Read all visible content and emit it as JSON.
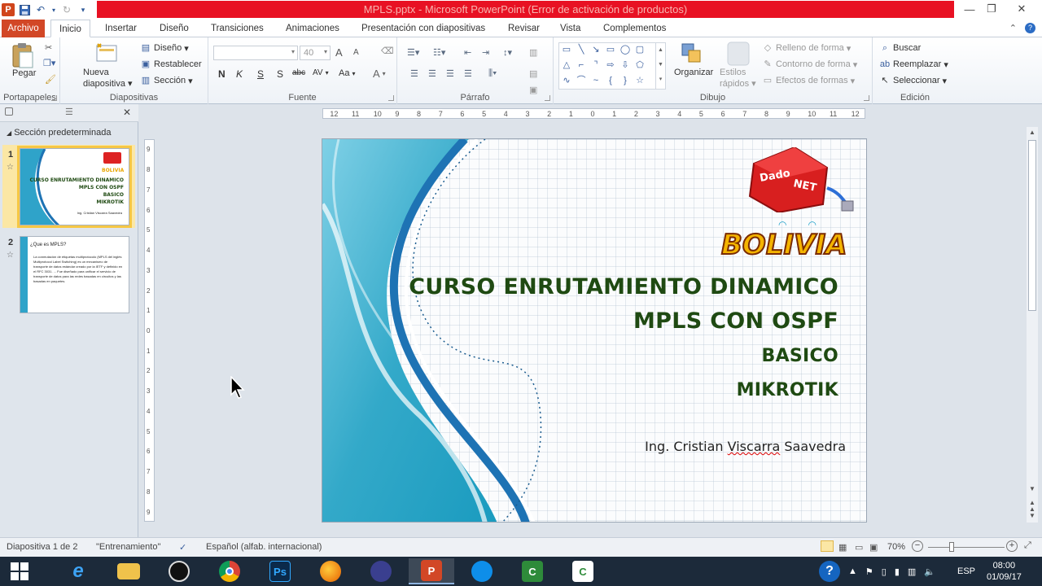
{
  "window": {
    "title": "MPLS.pptx  -  Microsoft PowerPoint (Error de activación de productos)",
    "controls": {
      "minimize": "—",
      "restore": "❐",
      "close": "✕"
    }
  },
  "qat": {
    "logo": "P"
  },
  "tabs": {
    "file": "Archivo",
    "items": [
      "Inicio",
      "Insertar",
      "Diseño",
      "Transiciones",
      "Animaciones",
      "Presentación con diapositivas",
      "Revisar",
      "Vista",
      "Complementos"
    ],
    "active": "Inicio"
  },
  "ribbon": {
    "portapapeles": {
      "label": "Portapapeles",
      "paste": "Pegar"
    },
    "diapositivas": {
      "label": "Diapositivas",
      "new_slide_1": "Nueva",
      "new_slide_2": "diapositiva",
      "layout": "Diseño",
      "reset": "Restablecer",
      "section": "Sección"
    },
    "fuente": {
      "label": "Fuente",
      "font_name": "",
      "font_size": "40",
      "bold": "N",
      "italic": "K",
      "underline": "S",
      "shadow": "S",
      "strike": "abc",
      "spacing": "AV",
      "case": "Aa",
      "color": "A",
      "grow": "A",
      "shrink": "A"
    },
    "parrafo": {
      "label": "Párrafo"
    },
    "dibujo": {
      "label": "Dibujo",
      "arrange": "Organizar",
      "quick_styles_1": "Estilos",
      "quick_styles_2": "rápidos",
      "fill": "Relleno de forma",
      "outline": "Contorno de forma",
      "effects": "Efectos de formas"
    },
    "edicion": {
      "label": "Edición",
      "find": "Buscar",
      "replace": "Reemplazar",
      "select": "Seleccionar"
    }
  },
  "left_panel": {
    "section": "Sección predeterminada",
    "slides": [
      {
        "number": "1",
        "title_line1": "CURSO ENRUTAMIENTO DINAMICO",
        "title_line2": "MPLS CON OSPF",
        "line3": "BASICO",
        "line4": "MIKROTIK",
        "author": "Ing. Cristian Viscarra Saavedra"
      },
      {
        "number": "2",
        "title": "¿Que es MPLS?",
        "body": "La conmutación de etiquetas multiprotocolo (MPLS del inglés Multiprotocol Label Switching) es un mecanismo de transporte de datos estándar creado por la IETF y definido en el RFC 3031. ... Fue diseñado para unificar el servicio de transporte de datos para las redes basadas en circuitos y las basadas en paquetes."
      }
    ]
  },
  "slide": {
    "logo_text": "Dado NET",
    "brand": "BOLIVIA",
    "title_line1": "CURSO ENRUTAMIENTO DINAMICO",
    "title_line2": "MPLS CON OSPF",
    "line3": "BASICO",
    "line4": "MIKROTIK",
    "author_prefix": "Ing. Cristian ",
    "author_squiggle": "Viscarra",
    "author_suffix": " Saavedra"
  },
  "ruler": {
    "h_ticks": [
      "12",
      "11",
      "10",
      "9",
      "8",
      "7",
      "6",
      "5",
      "4",
      "3",
      "2",
      "1",
      "0",
      "1",
      "2",
      "3",
      "4",
      "5",
      "6",
      "7",
      "8",
      "9",
      "10",
      "11",
      "12"
    ],
    "v_ticks": [
      "9",
      "8",
      "7",
      "6",
      "5",
      "4",
      "3",
      "2",
      "1",
      "0",
      "1",
      "2",
      "3",
      "4",
      "5",
      "6",
      "7",
      "8",
      "9"
    ]
  },
  "status": {
    "slide_info": "Diapositiva 1 de 2",
    "theme": "\"Entrenamiento\"",
    "language": "Español (alfab. internacional)",
    "zoom": "70%"
  },
  "taskbar": {
    "apps": [
      "start",
      "internet-explorer",
      "file-explorer",
      "obs",
      "chrome",
      "photoshop",
      "firefox",
      "eclipse",
      "powerpoint",
      "teamviewer",
      "camtasia",
      "camtasia-recorder"
    ],
    "language": "ESP",
    "time": "08:00",
    "date": "01/09/17"
  },
  "colors": {
    "accent": "#d24726",
    "title_green": "#1f4a12",
    "title_bar_red": "#e81123",
    "taskbar": "#1c2a3a"
  }
}
